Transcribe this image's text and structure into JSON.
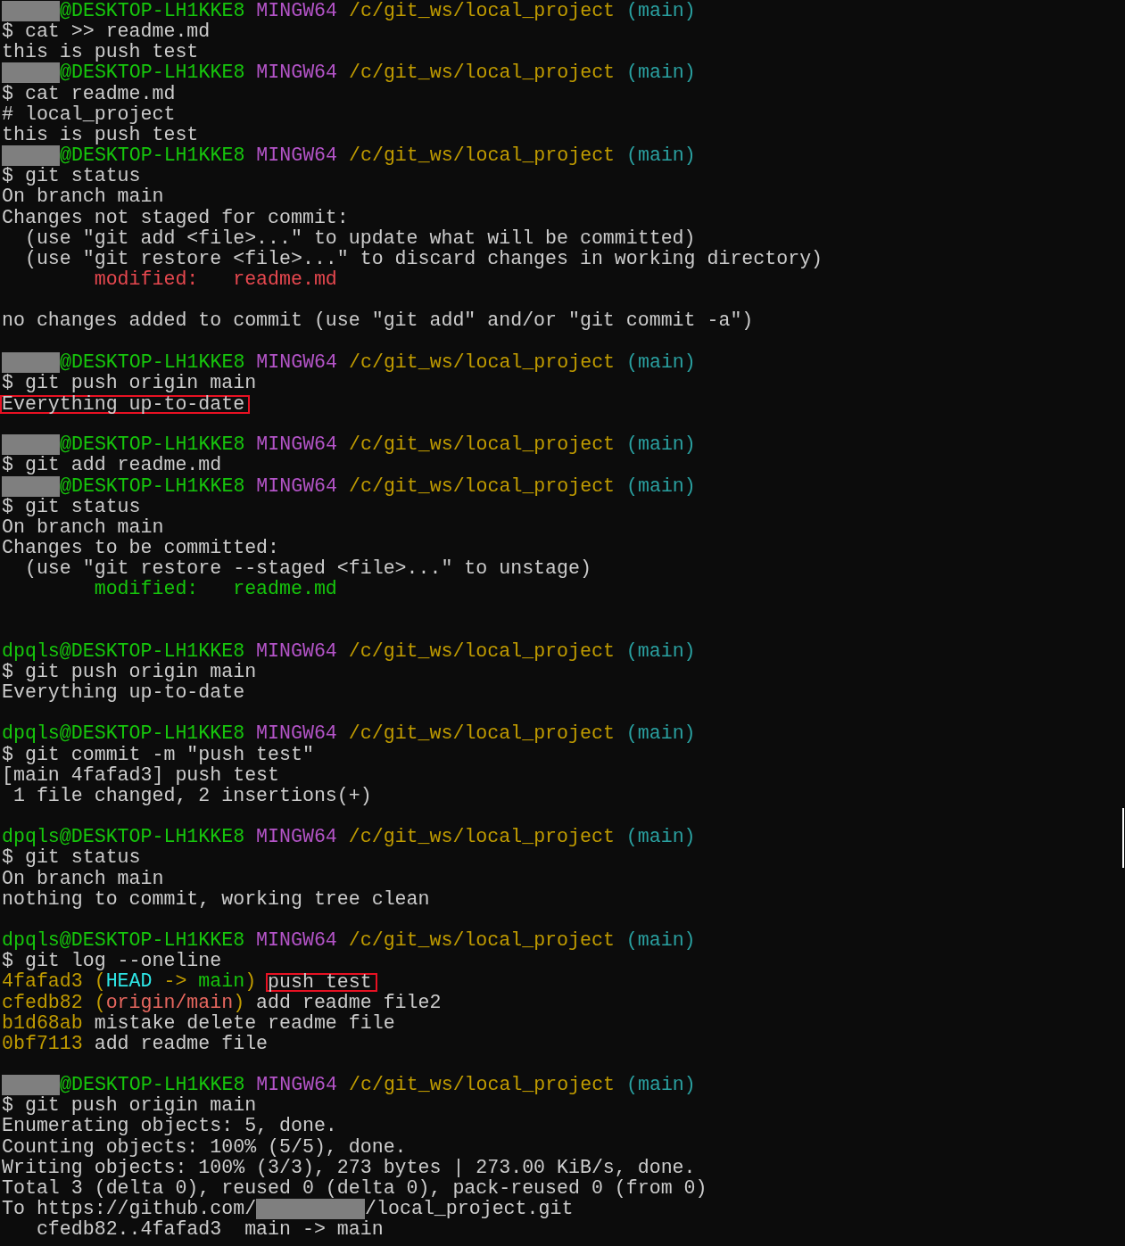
{
  "terminal": {
    "lines": [
      {
        "kind": "prompt",
        "redacted": true,
        "login": "@DESKTOP-LH1KKE8",
        "system": "MINGW64",
        "path": "/c/git_ws/local_project",
        "branch": "(main)"
      },
      {
        "kind": "text",
        "segments": [
          {
            "kind": "command",
            "text": "$ cat >> readme.md",
            "color": "#cccccc"
          }
        ]
      },
      {
        "kind": "text",
        "segments": [
          {
            "kind": "output",
            "text": "this is push test",
            "color": "#cccccc"
          }
        ]
      },
      {
        "kind": "prompt",
        "redacted": true,
        "login": "@DESKTOP-LH1KKE8",
        "system": "MINGW64",
        "path": "/c/git_ws/local_project",
        "branch": "(main)"
      },
      {
        "kind": "text",
        "segments": [
          {
            "kind": "command",
            "text": "$ cat readme.md",
            "color": "#cccccc"
          }
        ]
      },
      {
        "kind": "text",
        "segments": [
          {
            "kind": "output",
            "text": "# local_project",
            "color": "#cccccc"
          }
        ]
      },
      {
        "kind": "text",
        "segments": [
          {
            "kind": "output",
            "text": "this is push test",
            "color": "#cccccc"
          }
        ]
      },
      {
        "kind": "prompt",
        "redacted": true,
        "login": "@DESKTOP-LH1KKE8",
        "system": "MINGW64",
        "path": "/c/git_ws/local_project",
        "branch": "(main)"
      },
      {
        "kind": "text",
        "segments": [
          {
            "kind": "command",
            "text": "$ git status",
            "color": "#cccccc"
          }
        ]
      },
      {
        "kind": "text",
        "segments": [
          {
            "kind": "output",
            "text": "On branch main",
            "color": "#cccccc"
          }
        ]
      },
      {
        "kind": "text",
        "segments": [
          {
            "kind": "output",
            "text": "Changes not staged for commit:",
            "color": "#cccccc"
          }
        ]
      },
      {
        "kind": "text",
        "segments": [
          {
            "kind": "output",
            "text": "  (use \"git add <file>...\" to update what will be committed)",
            "color": "#cccccc"
          }
        ]
      },
      {
        "kind": "text",
        "segments": [
          {
            "kind": "output",
            "text": "  (use \"git restore <file>...\" to discard changes in working directory)",
            "color": "#cccccc"
          }
        ]
      },
      {
        "kind": "text",
        "segments": [
          {
            "kind": "output",
            "text": "        modified:   readme.md",
            "color": "#e7484f"
          }
        ]
      },
      {
        "kind": "blank"
      },
      {
        "kind": "text",
        "segments": [
          {
            "kind": "output",
            "text": "no changes added to commit (use \"git add\" and/or \"git commit -a\")",
            "color": "#cccccc"
          }
        ]
      },
      {
        "kind": "blank"
      },
      {
        "kind": "prompt",
        "redacted": true,
        "login": "@DESKTOP-LH1KKE8",
        "system": "MINGW64",
        "path": "/c/git_ws/local_project",
        "branch": "(main)"
      },
      {
        "kind": "text",
        "segments": [
          {
            "kind": "command",
            "text": "$ git push origin main",
            "color": "#cccccc"
          }
        ]
      },
      {
        "kind": "text",
        "segments": [
          {
            "kind": "output",
            "text": "Everything up-to-date",
            "color": "#cccccc",
            "boxed": true
          }
        ]
      },
      {
        "kind": "blank"
      },
      {
        "kind": "prompt",
        "redacted": true,
        "login": "@DESKTOP-LH1KKE8",
        "system": "MINGW64",
        "path": "/c/git_ws/local_project",
        "branch": "(main)"
      },
      {
        "kind": "text",
        "segments": [
          {
            "kind": "command",
            "text": "$ git add readme.md",
            "color": "#cccccc"
          }
        ]
      },
      {
        "kind": "prompt",
        "redacted": true,
        "login": "@DESKTOP-LH1KKE8",
        "system": "MINGW64",
        "path": "/c/git_ws/local_project",
        "branch": "(main)"
      },
      {
        "kind": "text",
        "segments": [
          {
            "kind": "command",
            "text": "$ git status",
            "color": "#cccccc"
          }
        ]
      },
      {
        "kind": "text",
        "segments": [
          {
            "kind": "output",
            "text": "On branch main",
            "color": "#cccccc"
          }
        ]
      },
      {
        "kind": "text",
        "segments": [
          {
            "kind": "output",
            "text": "Changes to be committed:",
            "color": "#cccccc"
          }
        ]
      },
      {
        "kind": "text",
        "segments": [
          {
            "kind": "output",
            "text": "  (use \"git restore --staged <file>...\" to unstage)",
            "color": "#cccccc"
          }
        ]
      },
      {
        "kind": "text",
        "segments": [
          {
            "kind": "output",
            "text": "        modified:   readme.md",
            "color": "#16c60c"
          }
        ]
      },
      {
        "kind": "blank"
      },
      {
        "kind": "blank"
      },
      {
        "kind": "prompt",
        "redacted": false,
        "login": "dpqls@DESKTOP-LH1KKE8",
        "system": "MINGW64",
        "path": "/c/git_ws/local_project",
        "branch": "(main)"
      },
      {
        "kind": "text",
        "segments": [
          {
            "kind": "command",
            "text": "$ git push origin main",
            "color": "#cccccc"
          }
        ]
      },
      {
        "kind": "text",
        "segments": [
          {
            "kind": "output",
            "text": "Everything up-to-date",
            "color": "#cccccc"
          }
        ]
      },
      {
        "kind": "blank"
      },
      {
        "kind": "prompt",
        "redacted": false,
        "login": "dpqls@DESKTOP-LH1KKE8",
        "system": "MINGW64",
        "path": "/c/git_ws/local_project",
        "branch": "(main)"
      },
      {
        "kind": "text",
        "segments": [
          {
            "kind": "command",
            "text": "$ git commit -m \"push test\"",
            "color": "#cccccc"
          }
        ]
      },
      {
        "kind": "text",
        "segments": [
          {
            "kind": "output",
            "text": "[main 4fafad3] push test",
            "color": "#cccccc"
          }
        ]
      },
      {
        "kind": "text",
        "segments": [
          {
            "kind": "output",
            "text": " 1 file changed, 2 insertions(+)",
            "color": "#cccccc"
          }
        ]
      },
      {
        "kind": "blank"
      },
      {
        "kind": "prompt",
        "redacted": false,
        "login": "dpqls@DESKTOP-LH1KKE8",
        "system": "MINGW64",
        "path": "/c/git_ws/local_project",
        "branch": "(main)"
      },
      {
        "kind": "text",
        "segments": [
          {
            "kind": "command",
            "text": "$ git status",
            "color": "#cccccc"
          }
        ]
      },
      {
        "kind": "text",
        "segments": [
          {
            "kind": "output",
            "text": "On branch main",
            "color": "#cccccc"
          }
        ]
      },
      {
        "kind": "text",
        "segments": [
          {
            "kind": "output",
            "text": "nothing to commit, working tree clean",
            "color": "#cccccc"
          }
        ]
      },
      {
        "kind": "blank"
      },
      {
        "kind": "prompt",
        "redacted": false,
        "login": "dpqls@DESKTOP-LH1KKE8",
        "system": "MINGW64",
        "path": "/c/git_ws/local_project",
        "branch": "(main)"
      },
      {
        "kind": "text",
        "segments": [
          {
            "kind": "command",
            "text": "$ git log --oneline",
            "color": "#cccccc"
          }
        ]
      },
      {
        "kind": "text",
        "segments": [
          {
            "kind": "hash",
            "text": "4fafad3",
            "color": "#c19c00"
          },
          {
            "kind": "punct",
            "text": " (",
            "color": "#c19c00"
          },
          {
            "kind": "ref",
            "text": "HEAD",
            "color": "#2ee6e6"
          },
          {
            "kind": "punct",
            "text": " -> ",
            "color": "#c19c00"
          },
          {
            "kind": "ref",
            "text": "main",
            "color": "#16c60c"
          },
          {
            "kind": "punct",
            "text": ") ",
            "color": "#c19c00"
          },
          {
            "kind": "message",
            "text": "push test",
            "color": "#cccccc",
            "boxed": true
          }
        ]
      },
      {
        "kind": "text",
        "segments": [
          {
            "kind": "hash",
            "text": "cfedb82",
            "color": "#c19c00"
          },
          {
            "kind": "punct",
            "text": " (",
            "color": "#c19c00"
          },
          {
            "kind": "ref",
            "text": "origin/main",
            "color": "#e7675f"
          },
          {
            "kind": "punct",
            "text": ")",
            "color": "#c19c00"
          },
          {
            "kind": "message",
            "text": " add readme file2",
            "color": "#cccccc"
          }
        ]
      },
      {
        "kind": "text",
        "segments": [
          {
            "kind": "hash",
            "text": "b1d68ab",
            "color": "#c19c00"
          },
          {
            "kind": "message",
            "text": " mistake delete readme file",
            "color": "#cccccc"
          }
        ]
      },
      {
        "kind": "text",
        "segments": [
          {
            "kind": "hash",
            "text": "0bf7113",
            "color": "#c19c00"
          },
          {
            "kind": "message",
            "text": " add readme file",
            "color": "#cccccc"
          }
        ]
      },
      {
        "kind": "blank"
      },
      {
        "kind": "prompt",
        "redacted": true,
        "login": "@DESKTOP-LH1KKE8",
        "system": "MINGW64",
        "path": "/c/git_ws/local_project",
        "branch": "(main)"
      },
      {
        "kind": "text",
        "segments": [
          {
            "kind": "command",
            "text": "$ git push origin main",
            "color": "#cccccc"
          }
        ]
      },
      {
        "kind": "text",
        "segments": [
          {
            "kind": "output",
            "text": "Enumerating objects: 5, done.",
            "color": "#cccccc"
          }
        ]
      },
      {
        "kind": "text",
        "segments": [
          {
            "kind": "output",
            "text": "Counting objects: 100% (5/5), done.",
            "color": "#cccccc"
          }
        ]
      },
      {
        "kind": "text",
        "segments": [
          {
            "kind": "output",
            "text": "Writing objects: 100% (3/3), 273 bytes | 273.00 KiB/s, done.",
            "color": "#cccccc"
          }
        ]
      },
      {
        "kind": "text",
        "segments": [
          {
            "kind": "output",
            "text": "Total 3 (delta 0), reused 0 (delta 0), pack-reused 0 (from 0)",
            "color": "#cccccc"
          }
        ]
      },
      {
        "kind": "text",
        "segments": [
          {
            "kind": "output",
            "text": "To https://github.com/",
            "color": "#cccccc"
          },
          {
            "kind": "redacted"
          },
          {
            "kind": "output",
            "text": "/local_project.git",
            "color": "#cccccc"
          }
        ]
      },
      {
        "kind": "text",
        "segments": [
          {
            "kind": "output",
            "text": "   cfedb82..4fafad3  main -> main",
            "color": "#cccccc"
          }
        ]
      }
    ]
  }
}
